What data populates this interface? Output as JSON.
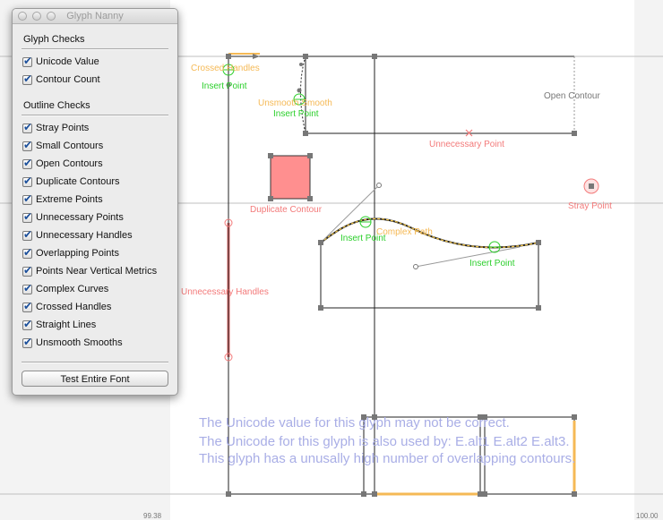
{
  "window": {
    "title": "Glyph Nanny"
  },
  "sections": [
    {
      "title": "Glyph Checks",
      "items": [
        {
          "label": "Unicode Value",
          "checked": true
        },
        {
          "label": "Contour Count",
          "checked": true
        }
      ]
    },
    {
      "title": "Outline Checks",
      "items": [
        {
          "label": "Stray Points",
          "checked": true
        },
        {
          "label": "Small Contours",
          "checked": true
        },
        {
          "label": "Open Contours",
          "checked": true
        },
        {
          "label": "Duplicate Contours",
          "checked": true
        },
        {
          "label": "Extreme Points",
          "checked": true
        },
        {
          "label": "Unnecessary Points",
          "checked": true
        },
        {
          "label": "Unnecessary Handles",
          "checked": true
        },
        {
          "label": "Overlapping Points",
          "checked": true
        },
        {
          "label": "Points Near Vertical Metrics",
          "checked": true
        },
        {
          "label": "Complex Curves",
          "checked": true
        },
        {
          "label": "Crossed Handles",
          "checked": true
        },
        {
          "label": "Straight Lines",
          "checked": true
        },
        {
          "label": "Unsmooth Smooths",
          "checked": true
        }
      ]
    }
  ],
  "button": {
    "label": "Test Entire Font"
  },
  "annotations": {
    "crossed_handles": "Crossed Handles",
    "insert_point_1": "Insert Point",
    "unsmooth_smooth": "Unsmooth Smooth",
    "insert_point_2": "Insert Point",
    "open_contour": "Open Contour",
    "unnecessary_point": "Unnecessary Point",
    "duplicate_contour": "Duplicate Contour",
    "stray_point": "Stray Point",
    "insert_point_3": "Insert Point",
    "complex_path": "Complex Path",
    "insert_point_4": "Insert Point",
    "unnecessary_handles": "Unnecessary Handles"
  },
  "report": [
    "The Unicode value for this glyph may not be correct.",
    "The Unicode for this glyph is also used by: E.alt1 E.alt2 E.alt3.",
    "This glyph has a unusally high number of overlapping contours."
  ],
  "ruler": {
    "left": "99.38",
    "right": "100.00"
  },
  "colors": {
    "red_marker": "#f37a7a",
    "green_marker": "#2bcf2b",
    "orange_marker": "#f5b955",
    "report_text": "#a9aee6",
    "duplicate_fill": "#ff8f8f",
    "open_contour": "#777777"
  }
}
